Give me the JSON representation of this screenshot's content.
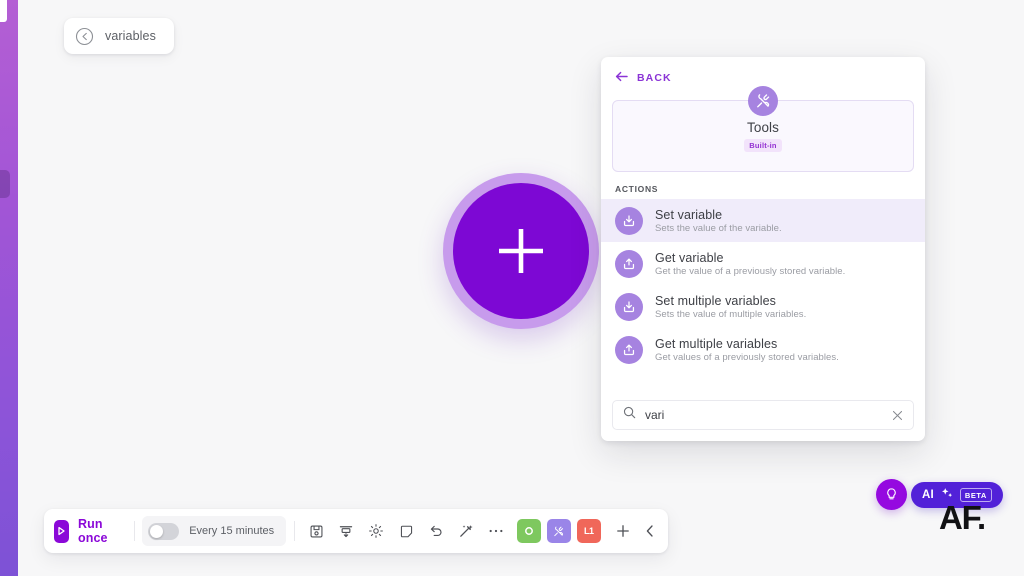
{
  "canvas": {
    "breadcrumb": {
      "icon": "back-circle-icon",
      "label": "variables"
    },
    "add_button": {
      "icon": "plus-icon",
      "label": ""
    },
    "rail": {
      "accent": "#a255d6"
    }
  },
  "panel": {
    "back": {
      "icon": "arrow-left-icon",
      "label": "BACK"
    },
    "piece": {
      "icon": "tools-icon",
      "title": "Tools",
      "badge": "Built-in"
    },
    "section_label": "ACTIONS",
    "actions": [
      {
        "icon": "set-variable-icon",
        "name": "Set variable",
        "description": "Sets the value of the variable.",
        "selected": true
      },
      {
        "icon": "get-variable-icon",
        "name": "Get variable",
        "description": "Get the value of a previously stored variable.",
        "selected": false
      },
      {
        "icon": "set-variable-icon",
        "name": "Set multiple variables",
        "description": "Sets the value of multiple variables.",
        "selected": false
      },
      {
        "icon": "get-variable-icon",
        "name": "Get multiple variables",
        "description": "Get values of a previously stored variables.",
        "selected": false
      }
    ],
    "search": {
      "icon": "search-icon",
      "value": "vari",
      "placeholder": "Search",
      "clear_icon": "close-icon"
    }
  },
  "toolbar": {
    "run": {
      "icon": "play-icon",
      "label": "Run once"
    },
    "schedule": {
      "enabled": false,
      "label": "Every 15 minutes"
    },
    "icons": [
      {
        "name": "save-icon"
      },
      {
        "name": "import-export-icon"
      },
      {
        "name": "settings-gear-icon"
      },
      {
        "name": "note-icon"
      },
      {
        "name": "undo-icon"
      },
      {
        "name": "magic-wand-icon"
      },
      {
        "name": "more-options-icon"
      }
    ],
    "chips": [
      {
        "name": "record-chip",
        "color": "#7ec85f",
        "glyph": "circle"
      },
      {
        "name": "tools-chip",
        "color": "#9a85e8",
        "glyph": "tools"
      },
      {
        "name": "code-chip",
        "color": "#f0675a",
        "glyph": "L1"
      }
    ],
    "add": {
      "icon": "plus-icon"
    },
    "collapse": {
      "icon": "chevron-left-icon"
    }
  },
  "assistant": {
    "bulb": {
      "icon": "lightbulb-icon"
    },
    "ai": {
      "label": "AI",
      "sparkle_icon": "sparkle-icon",
      "badge": "BETA"
    }
  },
  "watermark": {
    "text": "AF."
  }
}
